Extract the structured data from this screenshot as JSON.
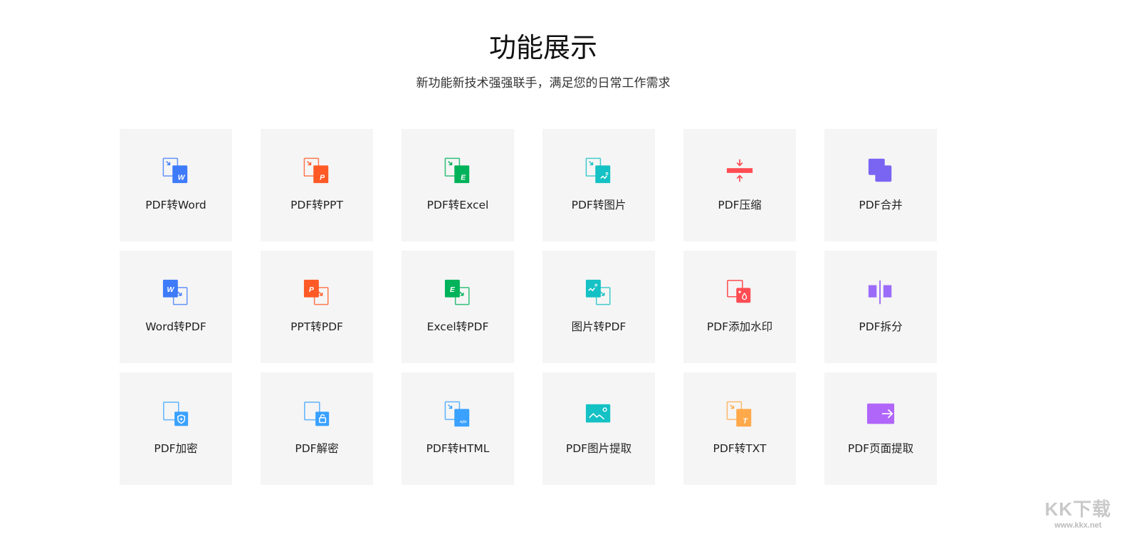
{
  "header": {
    "title": "功能展示",
    "subtitle": "新功能新技术强强联手，满足您的日常工作需求"
  },
  "features": [
    {
      "label": "PDF转Word",
      "icon": "pdf-to-word-icon",
      "type": "convert",
      "letter": "W",
      "color": "#3e7bfa"
    },
    {
      "label": "PDF转PPT",
      "icon": "pdf-to-ppt-icon",
      "type": "convert",
      "letter": "P",
      "color": "#ff5a26"
    },
    {
      "label": "PDF转Excel",
      "icon": "pdf-to-excel-icon",
      "type": "convert",
      "letter": "E",
      "color": "#00b259"
    },
    {
      "label": "PDF转图片",
      "icon": "pdf-to-image-icon",
      "type": "convert",
      "letter": "img",
      "color": "#14c1c4"
    },
    {
      "label": "PDF压缩",
      "icon": "pdf-compress-icon",
      "type": "compress",
      "letter": "",
      "color": "#ff4c52"
    },
    {
      "label": "PDF合并",
      "icon": "pdf-merge-icon",
      "type": "merge",
      "letter": "",
      "color": "#7a64f2"
    },
    {
      "label": "Word转PDF",
      "icon": "word-to-pdf-icon",
      "type": "reverse",
      "letter": "W",
      "color": "#3e7bfa"
    },
    {
      "label": "PPT转PDF",
      "icon": "ppt-to-pdf-icon",
      "type": "reverse",
      "letter": "P",
      "color": "#ff5a26"
    },
    {
      "label": "Excel转PDF",
      "icon": "excel-to-pdf-icon",
      "type": "reverse",
      "letter": "E",
      "color": "#00b259"
    },
    {
      "label": "图片转PDF",
      "icon": "image-to-pdf-icon",
      "type": "reverse",
      "letter": "img",
      "color": "#14c1c4"
    },
    {
      "label": "PDF添加水印",
      "icon": "pdf-watermark-icon",
      "type": "watermark",
      "letter": "",
      "color": "#ff4c52"
    },
    {
      "label": "PDF拆分",
      "icon": "pdf-split-icon",
      "type": "split",
      "letter": "",
      "color": "#9b6bfa"
    },
    {
      "label": "PDF加密",
      "icon": "pdf-encrypt-icon",
      "type": "lock",
      "letter": "shield",
      "color": "#3aa1ff"
    },
    {
      "label": "PDF解密",
      "icon": "pdf-decrypt-icon",
      "type": "lock",
      "letter": "unlock",
      "color": "#3aa1ff"
    },
    {
      "label": "PDF转HTML",
      "icon": "pdf-to-html-icon",
      "type": "convert",
      "letter": "</>",
      "color": "#3aa1ff"
    },
    {
      "label": "PDF图片提取",
      "icon": "pdf-image-extract-icon",
      "type": "picture",
      "letter": "",
      "color": "#14c1c4"
    },
    {
      "label": "PDF转TXT",
      "icon": "pdf-to-txt-icon",
      "type": "convert",
      "letter": "T",
      "color": "#ffa94a"
    },
    {
      "label": "PDF页面提取",
      "icon": "pdf-page-extract-icon",
      "type": "page",
      "letter": "",
      "color": "#b166fa"
    }
  ],
  "watermark": {
    "logo_text": "KK下载",
    "url_text": "www.kkx.net"
  }
}
